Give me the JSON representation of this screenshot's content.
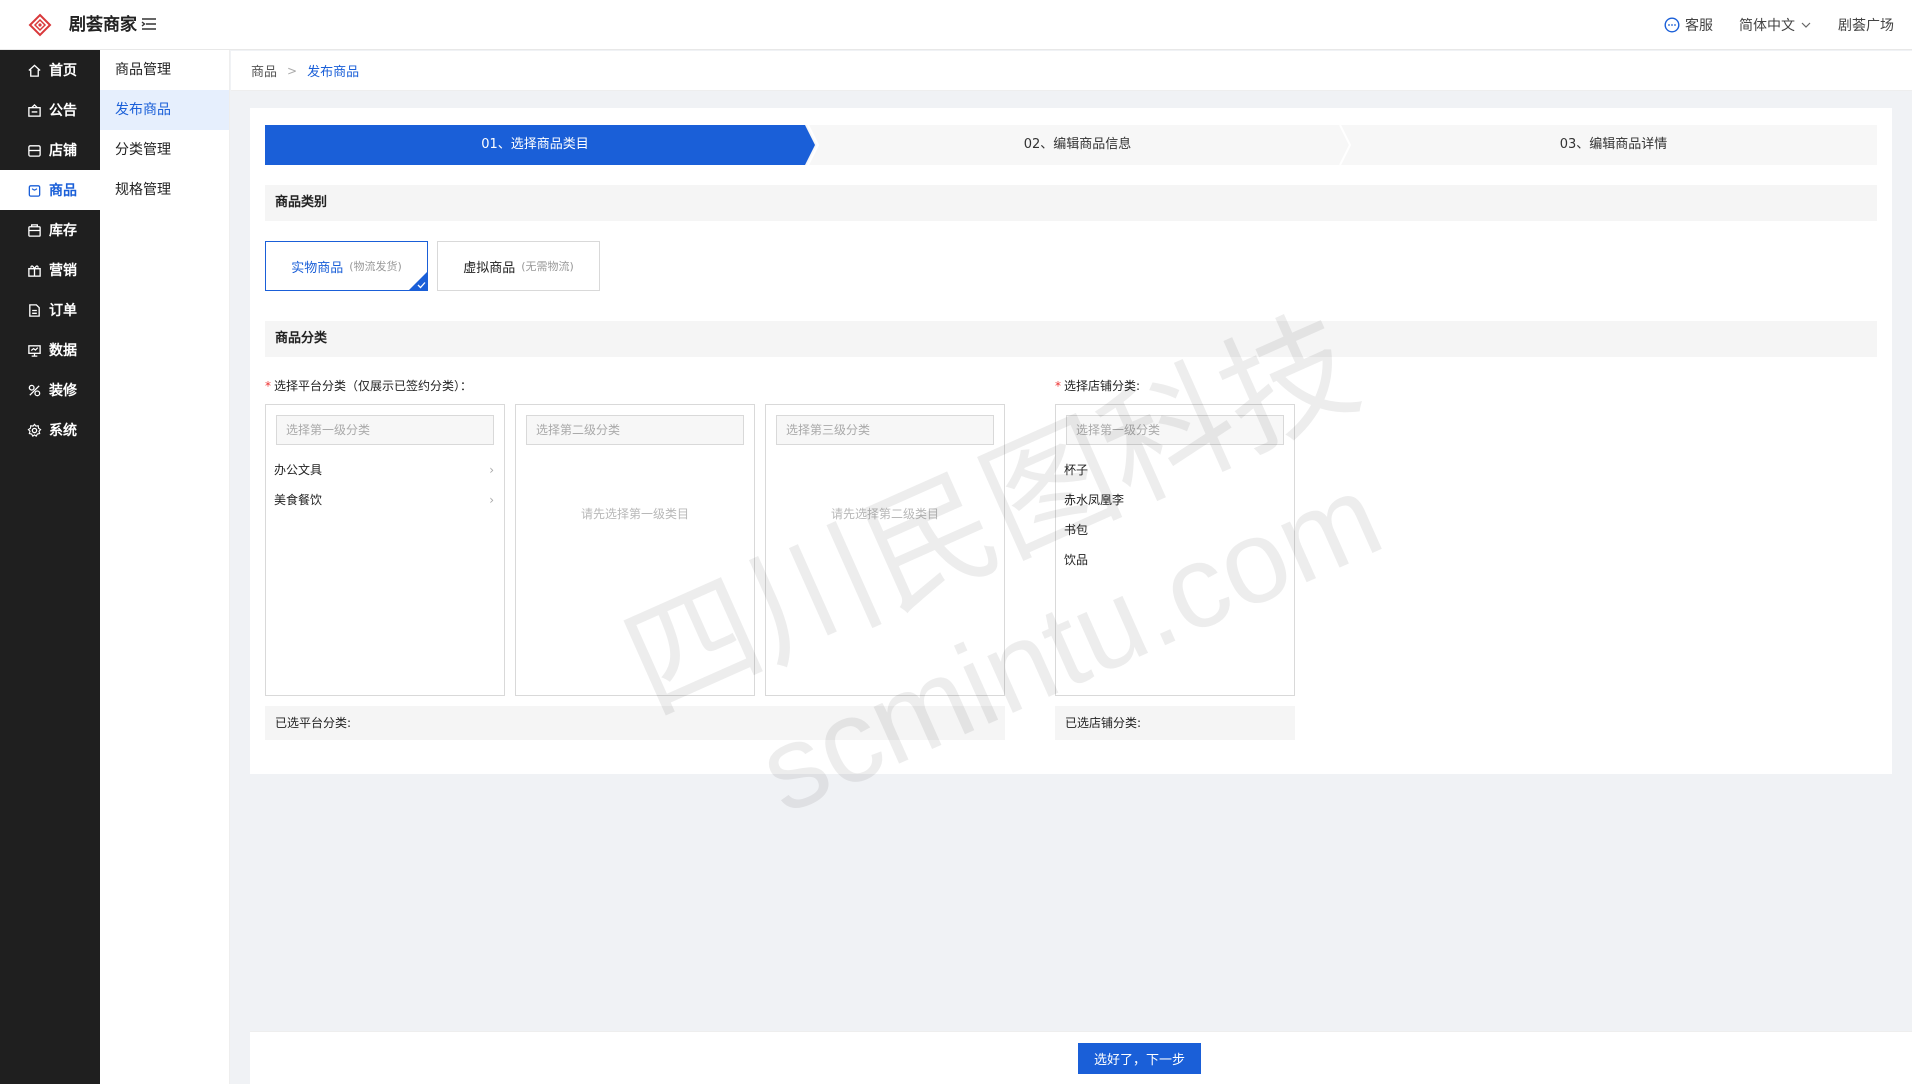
{
  "header": {
    "brand": "剧荟商家",
    "service": "客服",
    "language": "简体中文",
    "plaza": "剧荟广场"
  },
  "leftnav": {
    "items": [
      {
        "label": "首页",
        "icon": "home-icon"
      },
      {
        "label": "公告",
        "icon": "announcement-icon"
      },
      {
        "label": "店铺",
        "icon": "store-icon"
      },
      {
        "label": "商品",
        "icon": "bag-icon",
        "active": true
      },
      {
        "label": "库存",
        "icon": "inventory-icon"
      },
      {
        "label": "营销",
        "icon": "gift-icon"
      },
      {
        "label": "订单",
        "icon": "order-icon"
      },
      {
        "label": "数据",
        "icon": "data-icon"
      },
      {
        "label": "装修",
        "icon": "decorate-icon"
      },
      {
        "label": "系统",
        "icon": "settings-icon"
      }
    ]
  },
  "subnav": {
    "items": [
      {
        "label": "商品管理"
      },
      {
        "label": "发布商品",
        "active": true
      },
      {
        "label": "分类管理"
      },
      {
        "label": "规格管理"
      }
    ]
  },
  "breadcrumb": {
    "parent": "商品",
    "current": "发布商品"
  },
  "steps": {
    "items": [
      {
        "label": "01、选择商品类目",
        "active": true
      },
      {
        "label": "02、编辑商品信息"
      },
      {
        "label": "03、编辑商品详情"
      }
    ]
  },
  "sections": {
    "type_title": "商品类别",
    "category_title": "商品分类"
  },
  "product_types": [
    {
      "label": "实物商品",
      "hint": "(物流发货)",
      "selected": true
    },
    {
      "label": "虚拟商品",
      "hint": "(无需物流)"
    }
  ],
  "platform": {
    "label": "选择平台分类（仅展示已签约分类）：",
    "level1_placeholder": "选择第一级分类",
    "level2_placeholder": "选择第二级分类",
    "level3_placeholder": "选择第三级分类",
    "level1_items": [
      "办公文具",
      "美食餐饮"
    ],
    "level2_empty": "请先选择第一级类目",
    "level3_empty": "请先选择第二级类目",
    "selected_label": "已选平台分类:"
  },
  "store": {
    "label": "选择店铺分类:",
    "level1_placeholder": "选择第一级分类",
    "items": [
      "杯子",
      "赤水凤凰李",
      "书包",
      "饮品"
    ],
    "selected_label": "已选店铺分类:"
  },
  "actions": {
    "next": "选好了，下一步"
  },
  "watermark": {
    "line1": "四川民图科技",
    "line2": "scmintu.com"
  },
  "colors": {
    "primary": "#1a5fd8",
    "sidebar": "#1f1f1f"
  }
}
